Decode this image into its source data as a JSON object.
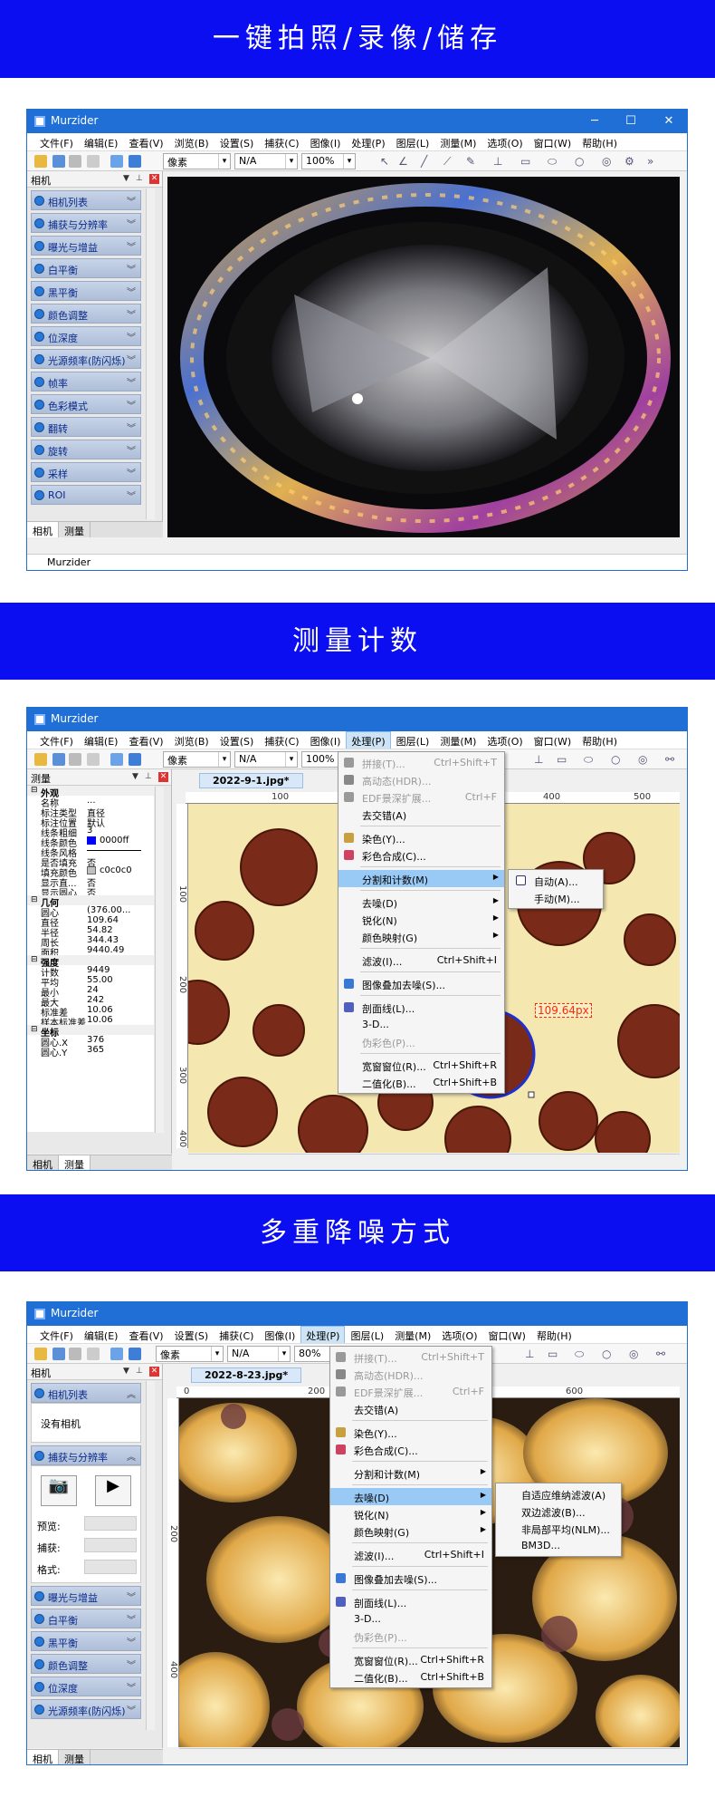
{
  "sections": [
    {
      "title": "一键拍照/录像/储存"
    },
    {
      "title": "测量计数"
    },
    {
      "title": "多重降噪方式"
    }
  ],
  "app": {
    "title": "Murzider",
    "minimize": "─",
    "maximize": "☐",
    "close": "✕",
    "status": "Murzider"
  },
  "menus": {
    "s1": [
      "文件(F)",
      "编辑(E)",
      "查看(V)",
      "浏览(B)",
      "设置(S)",
      "捕获(C)",
      "图像(I)",
      "处理(P)",
      "图层(L)",
      "测量(M)",
      "选项(O)",
      "窗口(W)",
      "帮助(H)"
    ],
    "s2": [
      "文件(F)",
      "编辑(E)",
      "查看(V)",
      "浏览(B)",
      "设置(S)",
      "捕获(C)",
      "图像(I)",
      "处理(P)",
      "图层(L)",
      "测量(M)",
      "选项(O)",
      "窗口(W)",
      "帮助(H)"
    ],
    "s3": [
      "文件(F)",
      "编辑(E)",
      "查看(V)",
      "设置(S)",
      "捕获(C)",
      "图像(I)",
      "处理(P)",
      "图层(L)",
      "测量(M)",
      "选项(O)",
      "窗口(W)",
      "帮助(H)"
    ]
  },
  "toolbar": {
    "unit": "像素",
    "na": "N/A",
    "zoom1": "100%",
    "zoom2": "100%",
    "zoom3": "80%"
  },
  "s1": {
    "panel_title": "相机",
    "folds": [
      "相机列表",
      "捕获与分辨率",
      "曝光与增益",
      "白平衡",
      "黑平衡",
      "颜色调整",
      "位深度",
      "光源频率(防闪烁)",
      "帧率",
      "色彩模式",
      "翻转",
      "旋转",
      "采样",
      "ROI"
    ],
    "tabs": [
      "相机",
      "测量"
    ]
  },
  "s2": {
    "panel_title": "测量",
    "doc_tab": "2022-9-1.jpg*",
    "rulers_h": [
      "100",
      "400",
      "500"
    ],
    "rulers_v": [
      "100",
      "200",
      "300",
      "400"
    ],
    "props": [
      {
        "type": "sec",
        "k": "外观"
      },
      {
        "k": "名称",
        "v": "..."
      },
      {
        "k": "标注类型",
        "v": "直径"
      },
      {
        "k": "标注位置",
        "v": "默认"
      },
      {
        "k": "线条粗细",
        "v": "3"
      },
      {
        "k": "线条颜色",
        "v": "0000ff"
      },
      {
        "k": "线条风格",
        "v": ""
      },
      {
        "k": "是否填充",
        "v": "否"
      },
      {
        "k": "填充颜色",
        "v": "c0c0c0"
      },
      {
        "k": "显示直...",
        "v": "否"
      },
      {
        "k": "显示圆心",
        "v": "否"
      },
      {
        "type": "sec",
        "k": "几何"
      },
      {
        "k": "圆心",
        "v": "(376.00..."
      },
      {
        "k": "直径",
        "v": "109.64"
      },
      {
        "k": "半径",
        "v": "54.82"
      },
      {
        "k": "周长",
        "v": "344.43"
      },
      {
        "k": "面积",
        "v": "9440.49"
      },
      {
        "type": "sec",
        "k": "强度"
      },
      {
        "k": "计数",
        "v": "9449"
      },
      {
        "k": "平均",
        "v": "55.00"
      },
      {
        "k": "最小",
        "v": "24"
      },
      {
        "k": "最大",
        "v": "242"
      },
      {
        "k": "标准差",
        "v": "10.06"
      },
      {
        "k": "样本标准差",
        "v": "10.06"
      },
      {
        "type": "sec",
        "k": "坐标"
      },
      {
        "k": "圆心.X",
        "v": "376"
      },
      {
        "k": "圆心.Y",
        "v": "365"
      }
    ],
    "measure_label": "109.64px",
    "menu": [
      {
        "label": "拼接(T)...",
        "sc": "Ctrl+Shift+T",
        "dis": true
      },
      {
        "label": "高动态(HDR)...",
        "dis": true
      },
      {
        "label": "EDF景深扩展...",
        "sc": "Ctrl+F",
        "dis": true
      },
      {
        "label": "去交错(A)"
      },
      {
        "sep": true
      },
      {
        "label": "染色(Y)..."
      },
      {
        "label": "彩色合成(C)..."
      },
      {
        "sep": true
      },
      {
        "label": "分割和计数(M)",
        "sub": true,
        "hl": true
      },
      {
        "sep": true
      },
      {
        "label": "去噪(D)",
        "sub": true
      },
      {
        "label": "锐化(N)",
        "sub": true
      },
      {
        "label": "颜色映射(G)",
        "sub": true
      },
      {
        "sep": true
      },
      {
        "label": "滤波(I)...",
        "sc": "Ctrl+Shift+I"
      },
      {
        "sep": true
      },
      {
        "label": "图像叠加去噪(S)..."
      },
      {
        "sep": true
      },
      {
        "label": "剖面线(L)..."
      },
      {
        "label": "3-D..."
      },
      {
        "label": "伪彩色(P)...",
        "dis": true
      },
      {
        "sep": true
      },
      {
        "label": "宽窗窗位(R)...",
        "sc": "Ctrl+Shift+R"
      },
      {
        "label": "二值化(B)...",
        "sc": "Ctrl+Shift+B"
      }
    ],
    "submenu": [
      "自动(A)...",
      "手动(M)..."
    ],
    "tabs": [
      "相机",
      "测量"
    ]
  },
  "s3": {
    "panel_title": "相机",
    "doc_tab": "2022-8-23.jpg*",
    "rulers_h": [
      "0",
      "200",
      "600"
    ],
    "rulers_v": [
      "200",
      "400"
    ],
    "camera_list": "相机列表",
    "no_camera": "没有相机",
    "capture": "捕获与分辨率",
    "form": [
      "预览:",
      "捕获:",
      "格式:"
    ],
    "folds": [
      "曝光与增益",
      "白平衡",
      "黑平衡",
      "颜色调整",
      "位深度",
      "光源频率(防闪烁)"
    ],
    "menu": [
      {
        "label": "拼接(T)...",
        "sc": "Ctrl+Shift+T",
        "dis": true
      },
      {
        "label": "高动态(HDR)...",
        "dis": true
      },
      {
        "label": "EDF景深扩展...",
        "sc": "Ctrl+F",
        "dis": true
      },
      {
        "label": "去交错(A)"
      },
      {
        "sep": true
      },
      {
        "label": "染色(Y)..."
      },
      {
        "label": "彩色合成(C)..."
      },
      {
        "sep": true
      },
      {
        "label": "分割和计数(M)",
        "sub": true
      },
      {
        "sep": true
      },
      {
        "label": "去噪(D)",
        "sub": true,
        "hl": true
      },
      {
        "label": "锐化(N)",
        "sub": true
      },
      {
        "label": "颜色映射(G)",
        "sub": true
      },
      {
        "sep": true
      },
      {
        "label": "滤波(I)...",
        "sc": "Ctrl+Shift+I"
      },
      {
        "sep": true
      },
      {
        "label": "图像叠加去噪(S)..."
      },
      {
        "sep": true
      },
      {
        "label": "剖面线(L)..."
      },
      {
        "label": "3-D..."
      },
      {
        "label": "伪彩色(P)...",
        "dis": true
      },
      {
        "sep": true
      },
      {
        "label": "宽窗窗位(R)...",
        "sc": "Ctrl+Shift+R"
      },
      {
        "label": "二值化(B)...",
        "sc": "Ctrl+Shift+B"
      }
    ],
    "submenu": [
      "自适应维纳滤波(A)",
      "双边滤波(B)...",
      "非局部平均(NLM)...",
      "BM3D..."
    ],
    "tabs": [
      "相机",
      "测量"
    ]
  },
  "colors": {
    "banner": "#0b0ef0",
    "titlebar": "#1f6fd6",
    "highlight": "#99c9f5"
  }
}
